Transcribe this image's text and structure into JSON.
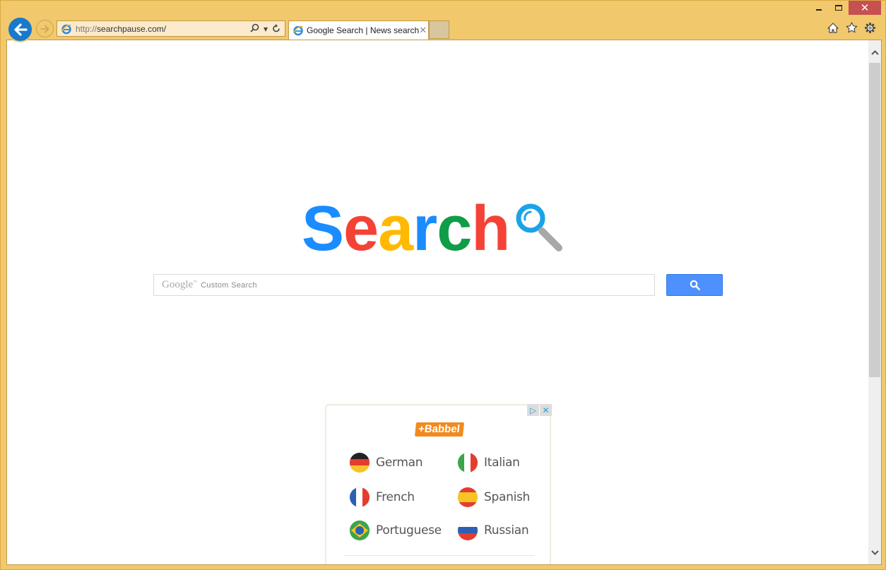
{
  "window": {
    "controls": {
      "minimize": "minimize",
      "maximize": "maximize",
      "close": "✕"
    }
  },
  "navigation": {
    "back_icon": "back-arrow-icon",
    "forward_icon": "forward-arrow-icon"
  },
  "address_bar": {
    "scheme": "http://",
    "host": "searchpause.com/",
    "tools": {
      "search": "⌕",
      "dropdown": "▾",
      "refresh": "↻"
    }
  },
  "tabs": [
    {
      "title": "Google Search | News search",
      "close": "✕",
      "active": true
    }
  ],
  "toolbar": {
    "icons": [
      "home-icon",
      "favorites-star-icon",
      "settings-gear-icon"
    ]
  },
  "page": {
    "logo": {
      "letters": [
        {
          "char": "S",
          "color": "#1a8cff"
        },
        {
          "char": "e",
          "color": "#f44336"
        },
        {
          "char": "a",
          "color": "#ffb900"
        },
        {
          "char": "r",
          "color": "#1a8cff"
        },
        {
          "char": "c",
          "color": "#0f9d48"
        },
        {
          "char": "h",
          "color": "#f44336"
        }
      ],
      "glass_ring_color": "#1ba3e8",
      "glass_handle_color": "#a8a8a8"
    },
    "search": {
      "google_mark": "Google",
      "tm": "™",
      "placeholder": "Custom Search",
      "button_color": "#4d90fe"
    }
  },
  "ad": {
    "brand": "+Babbel",
    "brand_color": "#f28a1e",
    "choices": {
      "info": "▷",
      "close": "✕"
    },
    "languages": [
      {
        "name": "German",
        "flag": "germany-flag-icon"
      },
      {
        "name": "Italian",
        "flag": "italy-flag-icon"
      },
      {
        "name": "French",
        "flag": "france-flag-icon"
      },
      {
        "name": "Spanish",
        "flag": "spain-flag-icon"
      },
      {
        "name": "Portuguese",
        "flag": "brazil-flag-icon"
      },
      {
        "name": "Russian",
        "flag": "russia-flag-icon"
      }
    ]
  },
  "scrollbar": {
    "position_fraction": 0.0,
    "visible_fraction": 0.6
  }
}
